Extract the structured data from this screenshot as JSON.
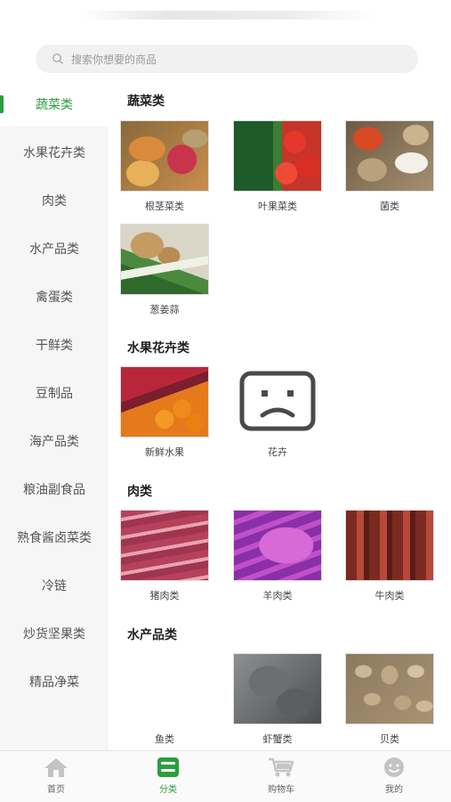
{
  "search": {
    "placeholder": "搜索你想要的商品"
  },
  "sidebar": {
    "items": [
      {
        "label": "蔬菜类",
        "active": true
      },
      {
        "label": "水果花卉类"
      },
      {
        "label": "肉类"
      },
      {
        "label": "水产品类"
      },
      {
        "label": "禽蛋类"
      },
      {
        "label": "干鲜类"
      },
      {
        "label": "豆制品"
      },
      {
        "label": "海产品类"
      },
      {
        "label": "粮油副食品"
      },
      {
        "label": "熟食酱卤菜类"
      },
      {
        "label": "冷链"
      },
      {
        "label": "炒货坚果类"
      },
      {
        "label": "精品净菜"
      }
    ]
  },
  "sections": [
    {
      "title": "蔬菜类",
      "items": [
        {
          "label": "根茎菜类",
          "image": "root-vegetables"
        },
        {
          "label": "叶果菜类",
          "image": "leaf-fruit-vegetables"
        },
        {
          "label": "菌类",
          "image": "mushrooms"
        },
        {
          "label": "葱姜蒜",
          "image": "scallion-ginger-garlic"
        }
      ]
    },
    {
      "title": "水果花卉类",
      "items": [
        {
          "label": "新鲜水果",
          "image": "fresh-fruit"
        },
        {
          "label": "花卉",
          "image": "sad-face-placeholder-icon"
        }
      ]
    },
    {
      "title": "肉类",
      "items": [
        {
          "label": "猪肉类",
          "image": "pork"
        },
        {
          "label": "羊肉类",
          "image": "lamb"
        },
        {
          "label": "牛肉类",
          "image": "beef"
        }
      ]
    },
    {
      "title": "水产品类",
      "items": [
        {
          "label": "鱼类",
          "image": "none"
        },
        {
          "label": "虾蟹类",
          "image": "shrimp-crab"
        },
        {
          "label": "贝类",
          "image": "shellfish"
        }
      ]
    }
  ],
  "tabbar": {
    "items": [
      {
        "label": "首页",
        "icon": "home-icon"
      },
      {
        "label": "分类",
        "icon": "category-icon",
        "active": true
      },
      {
        "label": "购物车",
        "icon": "cart-icon"
      },
      {
        "label": "我的",
        "icon": "profile-icon"
      }
    ]
  },
  "colors": {
    "accent": "#2e9d3e",
    "sidebar_bg": "#f6f6f6"
  }
}
